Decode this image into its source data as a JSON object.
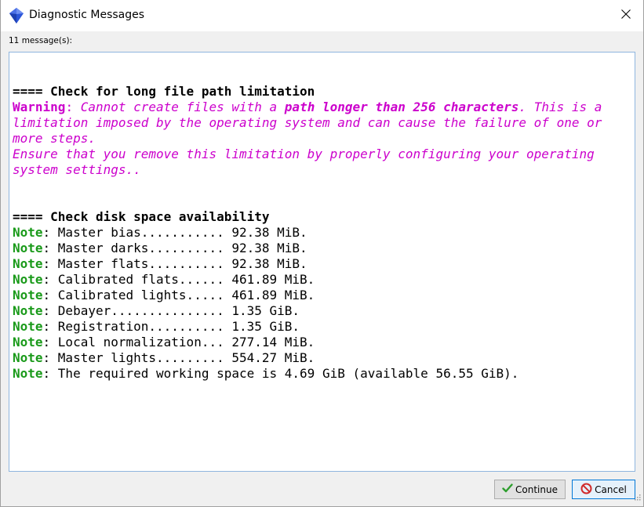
{
  "window": {
    "title": "Diagnostic Messages",
    "icon": "app-logo-icon",
    "close_icon": "close-icon"
  },
  "messages": {
    "count_label": "11 message(s):"
  },
  "log": {
    "section1_header": "==== Check for long file path limitation",
    "warning_label": "Warning",
    "colon": ":",
    "warning_text_a": " Cannot create files with a ",
    "warning_text_em": "path longer than 256 characters",
    "warning_text_b": ". This is a limitation imposed by the operating system and can cause the failure of one or more steps.",
    "warning_line2": "Ensure that you remove this limitation by properly configuring your operating system settings..",
    "section2_header": "==== Check disk space availability",
    "note_label": "Note",
    "notes": [
      ": Master bias........... 92.38 MiB.",
      ": Master darks.......... 92.38 MiB.",
      ": Master flats.......... 92.38 MiB.",
      ": Calibrated flats...... 461.89 MiB.",
      ": Calibrated lights..... 461.89 MiB.",
      ": Debayer............... 1.35 GiB.",
      ": Registration.......... 1.35 GiB.",
      ": Local normalization... 277.14 MiB.",
      ": Master lights......... 554.27 MiB.",
      ": The required working space is 4.69 GiB (available 56.55 GiB)."
    ]
  },
  "buttons": {
    "continue_label": "Continue",
    "continue_icon": "checkmark-icon",
    "cancel_label": "Cancel",
    "cancel_icon": "cancel-icon"
  },
  "colors": {
    "warning": "#cc00cc",
    "note": "#1a9a1a",
    "log_border": "#8fb5de",
    "focus_border": "#0078d7"
  }
}
